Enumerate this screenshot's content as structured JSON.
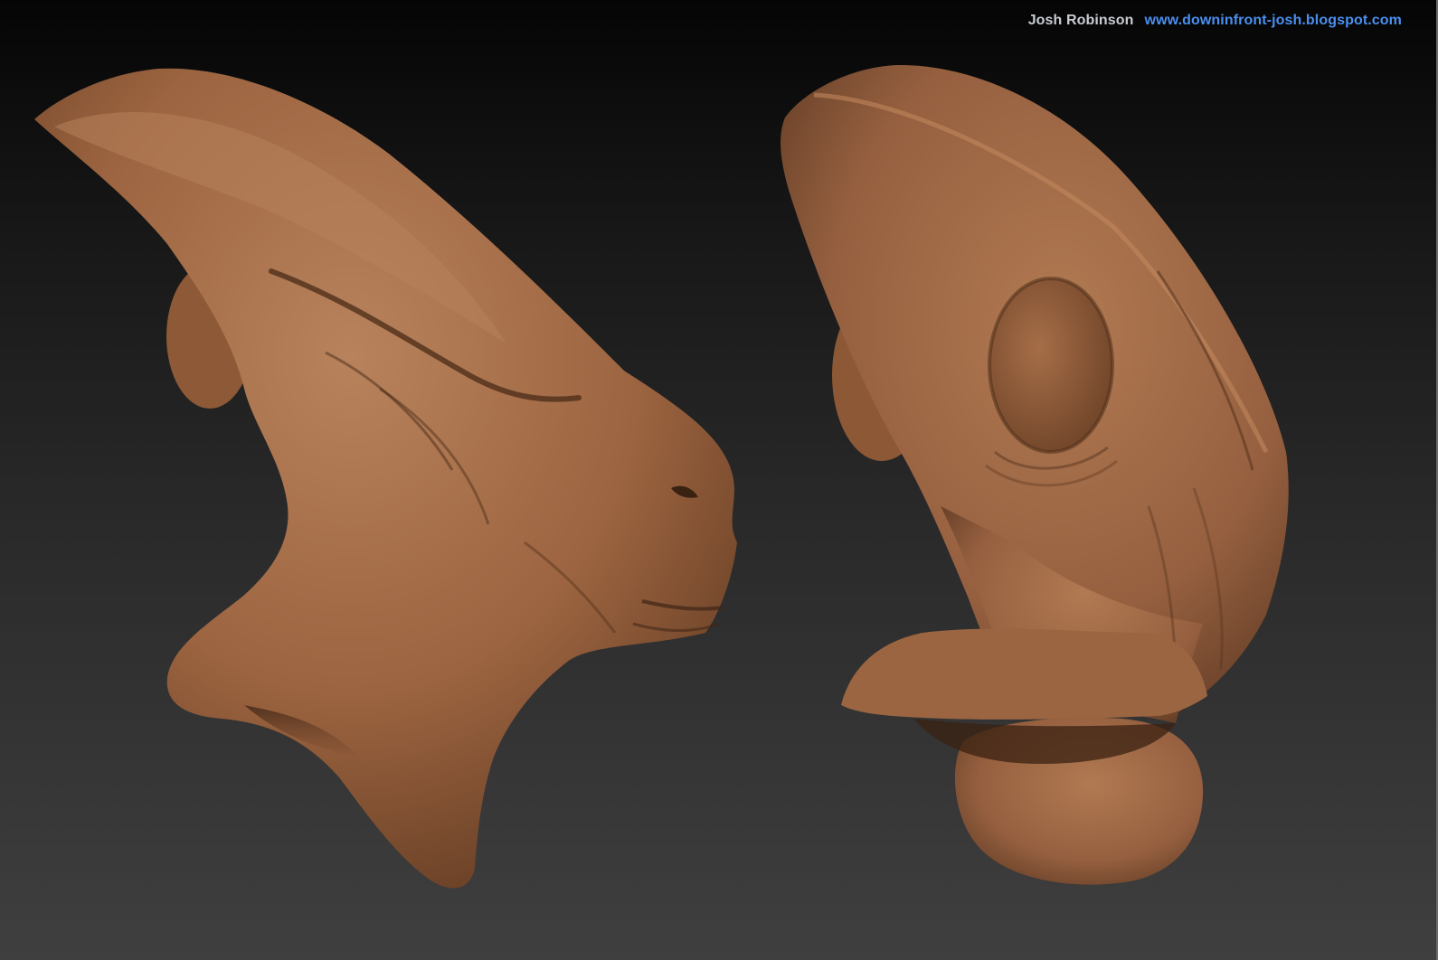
{
  "credits": {
    "author": "Josh Robinson",
    "website": "www.downinfront-josh.blogspot.com"
  },
  "colors": {
    "clay": "#9c6440",
    "clay_light": "#b27a53",
    "clay_dark": "#5a3620",
    "author_text": "#c8ccd2",
    "website_text": "#4a8ff0"
  }
}
